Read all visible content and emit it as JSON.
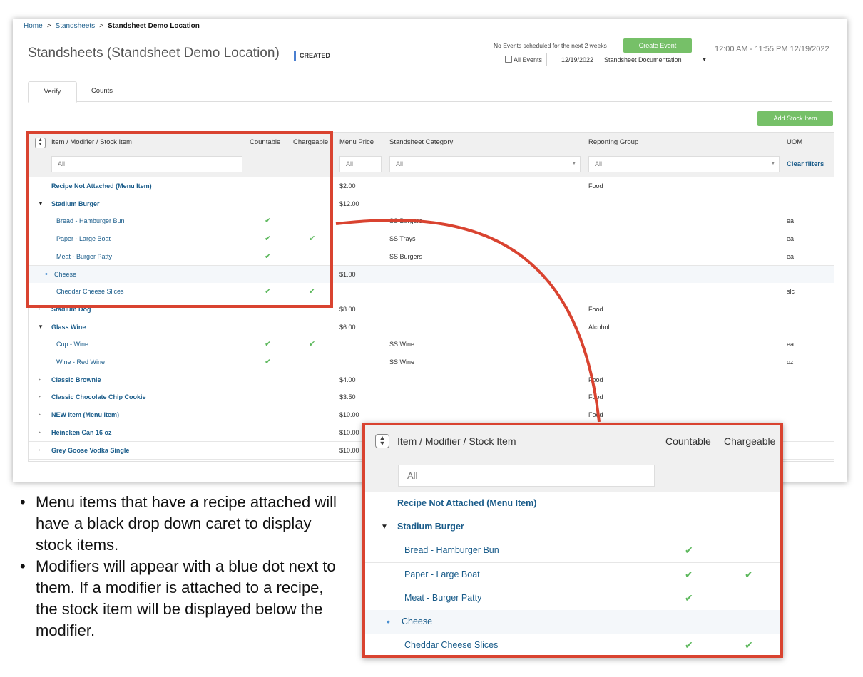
{
  "breadcrumb": {
    "home": "Home",
    "separator": ">",
    "standsheets": "Standsheets",
    "current": "Standsheet Demo Location"
  },
  "page": {
    "title": "Standsheets (Standsheet Demo Location)",
    "status": "CREATED"
  },
  "events": {
    "no_events_text": "No Events scheduled for the next 2 weeks",
    "create_button": "Create Event",
    "all_events_label": "All Events",
    "selected_date": "12/19/2022",
    "selected_name": "Standsheet Documentation",
    "time_range": "12:00 AM - 11:55 PM 12/19/2022"
  },
  "tabs": [
    {
      "label": "Verify",
      "active": true
    },
    {
      "label": "Counts",
      "active": false
    }
  ],
  "add_stock_button": "Add Stock Item",
  "columns": {
    "item": "Item / Modifier / Stock Item",
    "countable": "Countable",
    "chargeable": "Chargeable",
    "menu_price": "Menu Price",
    "category": "Standsheet Category",
    "reporting_group": "Reporting Group",
    "uom": "UOM"
  },
  "filters": {
    "item": "All",
    "price": "All",
    "category": "All",
    "reporting": "All",
    "clear": "Clear filters"
  },
  "rows": [
    {
      "type": "menu",
      "caret": "",
      "name": "Recipe Not Attached (Menu Item)",
      "countable": "",
      "chargeable": "",
      "price": "$2.00",
      "category": "",
      "reporting": "Food",
      "uom": ""
    },
    {
      "type": "menu",
      "caret": "▼",
      "name": "Stadium Burger",
      "countable": "",
      "chargeable": "",
      "price": "$12.00",
      "category": "",
      "reporting": "",
      "uom": ""
    },
    {
      "type": "stock",
      "caret": "",
      "name": "Bread - Hamburger Bun",
      "countable": "✔",
      "chargeable": "",
      "price": "",
      "category": "SS Burgers",
      "reporting": "",
      "uom": "ea"
    },
    {
      "type": "stock",
      "caret": "",
      "name": "Paper - Large Boat",
      "countable": "✔",
      "chargeable": "✔",
      "price": "",
      "category": "SS Trays",
      "reporting": "",
      "uom": "ea"
    },
    {
      "type": "stock",
      "caret": "",
      "name": "Meat - Burger Patty",
      "countable": "✔",
      "chargeable": "",
      "price": "",
      "category": "SS Burgers",
      "reporting": "",
      "uom": "ea"
    },
    {
      "type": "modifier",
      "caret": "•",
      "name": "Cheese",
      "countable": "",
      "chargeable": "",
      "price": "$1.00",
      "category": "",
      "reporting": "",
      "uom": ""
    },
    {
      "type": "stock",
      "caret": "",
      "name": "Cheddar Cheese Slices",
      "countable": "✔",
      "chargeable": "✔",
      "price": "",
      "category": "",
      "reporting": "",
      "uom": "slc"
    },
    {
      "type": "menu",
      "caret": "▸",
      "name": "Stadium Dog",
      "countable": "",
      "chargeable": "",
      "price": "$8.00",
      "category": "",
      "reporting": "Food",
      "uom": ""
    },
    {
      "type": "menu",
      "caret": "▼",
      "name": "Glass Wine",
      "countable": "",
      "chargeable": "",
      "price": "$6.00",
      "category": "",
      "reporting": "Alcohol",
      "uom": ""
    },
    {
      "type": "stock",
      "caret": "",
      "name": "Cup - Wine",
      "countable": "✔",
      "chargeable": "✔",
      "price": "",
      "category": "SS Wine",
      "reporting": "",
      "uom": "ea"
    },
    {
      "type": "stock",
      "caret": "",
      "name": "Wine - Red Wine",
      "countable": "✔",
      "chargeable": "",
      "price": "",
      "category": "SS Wine",
      "reporting": "",
      "uom": "oz"
    },
    {
      "type": "menu",
      "caret": "▸",
      "name": "Classic Brownie",
      "countable": "",
      "chargeable": "",
      "price": "$4.00",
      "category": "",
      "reporting": "Food",
      "uom": ""
    },
    {
      "type": "menu",
      "caret": "▸",
      "name": "Classic Chocolate Chip Cookie",
      "countable": "",
      "chargeable": "",
      "price": "$3.50",
      "category": "",
      "reporting": "Food",
      "uom": ""
    },
    {
      "type": "menu",
      "caret": "▸",
      "name": "NEW Item (Menu Item)",
      "countable": "",
      "chargeable": "",
      "price": "$10.00",
      "category": "",
      "reporting": "Food",
      "uom": ""
    },
    {
      "type": "menu",
      "caret": "▸",
      "name": "Heineken Can 16 oz",
      "countable": "",
      "chargeable": "",
      "price": "$10.00",
      "category": "",
      "reporting": "",
      "uom": ""
    },
    {
      "type": "menu",
      "caret": "▸",
      "name": "Grey Goose Vodka Single",
      "countable": "",
      "chargeable": "",
      "price": "$10.00",
      "category": "",
      "reporting": "",
      "uom": ""
    }
  ],
  "zoom": {
    "columns": {
      "item": "Item / Modifier / Stock Item",
      "countable": "Countable",
      "chargeable": "Chargeable"
    },
    "filter": "All",
    "rows": [
      {
        "type": "menu",
        "caret": "",
        "name": "Recipe Not Attached (Menu Item)",
        "countable": "",
        "chargeable": ""
      },
      {
        "type": "menu",
        "caret": "▼",
        "name": "Stadium Burger",
        "countable": "",
        "chargeable": ""
      },
      {
        "type": "stock",
        "caret": "",
        "name": "Bread - Hamburger Bun",
        "countable": "✔",
        "chargeable": ""
      },
      {
        "type": "stock",
        "caret": "",
        "name": "Paper - Large Boat",
        "countable": "✔",
        "chargeable": "✔"
      },
      {
        "type": "stock",
        "caret": "",
        "name": "Meat - Burger Patty",
        "countable": "✔",
        "chargeable": ""
      },
      {
        "type": "modifier",
        "caret": "•",
        "name": "Cheese",
        "countable": "",
        "chargeable": ""
      },
      {
        "type": "stock",
        "caret": "",
        "name": "Cheddar Cheese Slices",
        "countable": "✔",
        "chargeable": "✔"
      }
    ]
  },
  "notes": [
    {
      "bullet": "•",
      "text": "Menu items that have a recipe attached will have a black drop down caret to display stock items."
    },
    {
      "bullet": "•",
      "text": "Modifiers will appear with a blue dot next to them. If a modifier is attached to a recipe, the stock item will be displayed below the modifier."
    }
  ],
  "colors": {
    "accent_green": "#76c068",
    "link_blue": "#1a5c8a",
    "callout_red": "#d94330",
    "modifier_dot": "#4a8fd0",
    "status_bar": "#4a7fd0"
  }
}
